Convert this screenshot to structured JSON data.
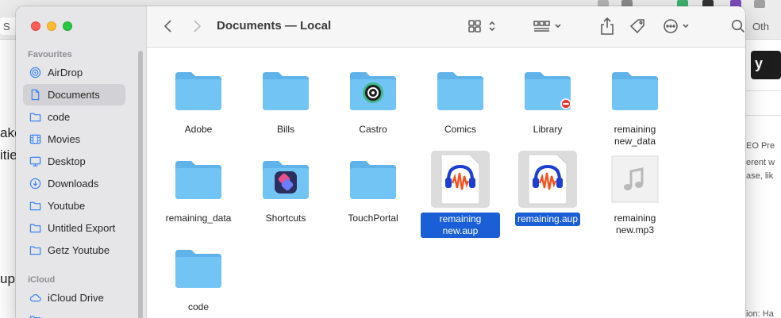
{
  "background": {
    "left_tab": "S",
    "right_tab": "Oth",
    "left_words": [
      "ake",
      "itie",
      "up"
    ],
    "right_words": [
      "EO Pre",
      "erent w",
      "ase, lik",
      "ion: Ha"
    ],
    "yoast": "y"
  },
  "window": {
    "title": "Documents — Local"
  },
  "sidebar": {
    "favourites_header": "Favourites",
    "icloud_header": "iCloud",
    "items": [
      {
        "label": "AirDrop",
        "icon": "airdrop-icon"
      },
      {
        "label": "Documents",
        "icon": "document-icon"
      },
      {
        "label": "code",
        "icon": "folder-icon"
      },
      {
        "label": "Movies",
        "icon": "film-icon"
      },
      {
        "label": "Desktop",
        "icon": "desktop-icon"
      },
      {
        "label": "Downloads",
        "icon": "download-icon"
      },
      {
        "label": "Youtube",
        "icon": "folder-icon"
      },
      {
        "label": "Untitled Export",
        "icon": "folder-icon"
      },
      {
        "label": "Getz Youtube",
        "icon": "folder-icon"
      }
    ],
    "icloud_items": [
      {
        "label": "iCloud Drive",
        "icon": "cloud-icon"
      }
    ],
    "selected": "Documents"
  },
  "files": [
    {
      "name": "Adobe",
      "kind": "folder"
    },
    {
      "name": "Bills",
      "kind": "folder"
    },
    {
      "name": "Castro",
      "kind": "folder-app"
    },
    {
      "name": "Comics",
      "kind": "folder"
    },
    {
      "name": "Library",
      "kind": "folder-restricted"
    },
    {
      "name": "remaining new_data",
      "kind": "folder"
    },
    {
      "name": "remaining_data",
      "kind": "folder"
    },
    {
      "name": "Shortcuts",
      "kind": "folder-app"
    },
    {
      "name": "TouchPortal",
      "kind": "folder"
    },
    {
      "name": "remaining new.aup",
      "kind": "audacity",
      "selected": true
    },
    {
      "name": "remaining.aup",
      "kind": "audacity",
      "selected": true
    },
    {
      "name": "remaining new.mp3",
      "kind": "audio"
    },
    {
      "name": "code",
      "kind": "folder"
    }
  ],
  "colors": {
    "folder": "#69bff3",
    "selection": "#1a5fd6",
    "sidebar_selected": "#d2d2d6"
  }
}
